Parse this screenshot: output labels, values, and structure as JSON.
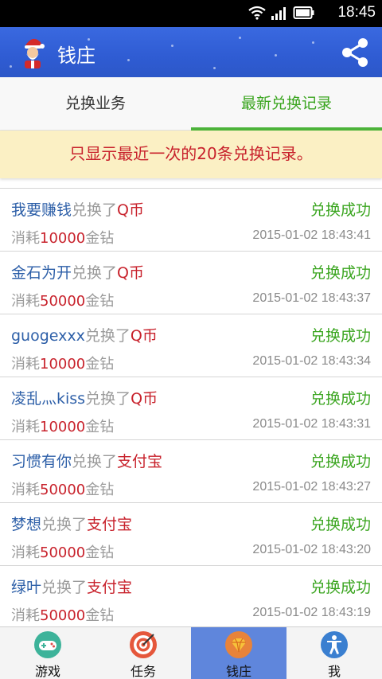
{
  "status_bar": {
    "time": "18:45"
  },
  "header": {
    "title": "钱庄"
  },
  "tabs": [
    {
      "label": "兑换业务"
    },
    {
      "label": "最新兑换记录"
    }
  ],
  "notice": "只显示最近一次的20条兑换记录。",
  "records": [
    {
      "user": "我要赚钱",
      "action": "兑换了",
      "item": "Q币",
      "consume": "消耗",
      "amount": "10000",
      "unit": "金钻",
      "status": "兑换成功",
      "time": "2015-01-02 18:43:41"
    },
    {
      "user": "金石为开",
      "action": "兑换了",
      "item": "Q币",
      "consume": "消耗",
      "amount": "50000",
      "unit": "金钻",
      "status": "兑换成功",
      "time": "2015-01-02 18:43:37"
    },
    {
      "user": "guogexxx",
      "action": "兑换了",
      "item": "Q币",
      "consume": "消耗",
      "amount": "10000",
      "unit": "金钻",
      "status": "兑换成功",
      "time": "2015-01-02 18:43:34"
    },
    {
      "user": "凌乱灬kiss",
      "action": "兑换了",
      "item": "Q币",
      "consume": "消耗",
      "amount": "10000",
      "unit": "金钻",
      "status": "兑换成功",
      "time": "2015-01-02 18:43:31"
    },
    {
      "user": "习惯有你",
      "action": "兑换了",
      "item": "支付宝",
      "consume": "消耗",
      "amount": "50000",
      "unit": "金钻",
      "status": "兑换成功",
      "time": "2015-01-02 18:43:27"
    },
    {
      "user": "梦想",
      "action": "兑换了",
      "item": "支付宝",
      "consume": "消耗",
      "amount": "50000",
      "unit": "金钻",
      "status": "兑换成功",
      "time": "2015-01-02 18:43:20"
    },
    {
      "user": "绿叶",
      "action": "兑换了",
      "item": "支付宝",
      "consume": "消耗",
      "amount": "50000",
      "unit": "金钻",
      "status": "兑换成功",
      "time": "2015-01-02 18:43:19"
    }
  ],
  "bottom_nav": [
    {
      "label": "游戏",
      "icon": "gamepad-icon"
    },
    {
      "label": "任务",
      "icon": "target-icon"
    },
    {
      "label": "钱庄",
      "icon": "diamond-icon"
    },
    {
      "label": "我",
      "icon": "person-icon"
    }
  ],
  "colors": {
    "header_blue": "#2f5cd3",
    "accent_green": "#3aa51f",
    "accent_red": "#c8222c",
    "username_blue": "#2d5fa8",
    "notice_bg": "#fbf0c4",
    "nav_active": "#5f86dc"
  }
}
